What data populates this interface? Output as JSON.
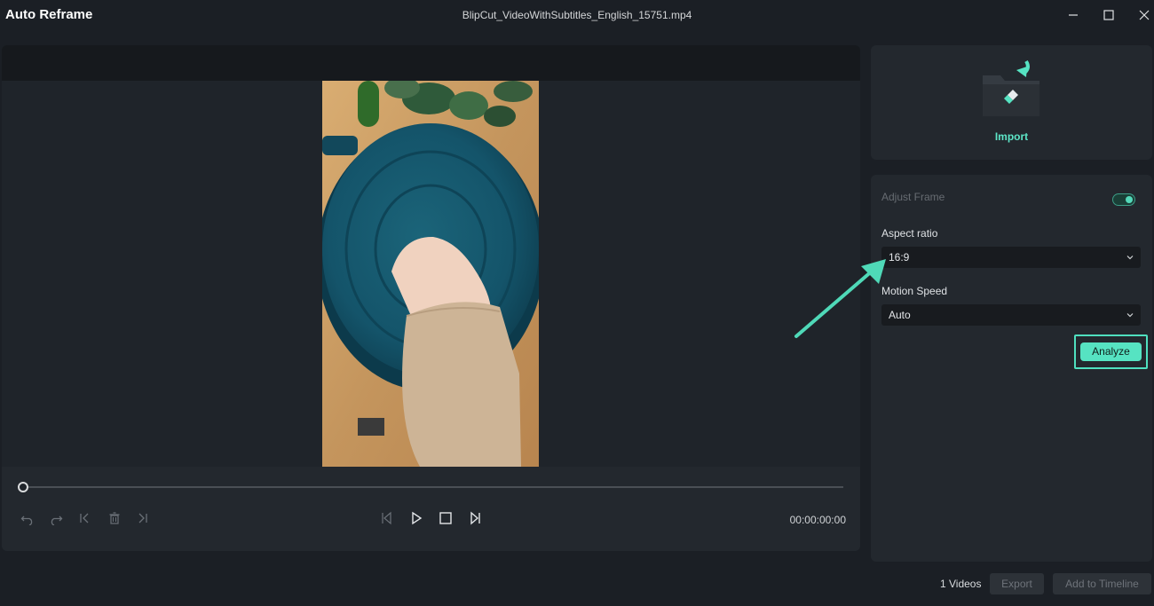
{
  "app": {
    "title": "Auto Reframe",
    "file_name": "BlipCut_VideoWithSubtitles_English_15751.mp4"
  },
  "window_controls": [
    "minimize-icon",
    "maximize-icon",
    "close-icon"
  ],
  "player": {
    "timecode": "00:00:00:00",
    "progress": 0,
    "left_controls": [
      "undo-icon",
      "redo-icon",
      "skip-start-icon",
      "delete-icon",
      "skip-end-icon"
    ],
    "center_controls": [
      "previous-frame-icon",
      "play-icon",
      "stop-icon",
      "next-frame-icon"
    ]
  },
  "import": {
    "label": "Import",
    "icon": "import-folder-icon"
  },
  "settings": {
    "adjust_frame_label": "Adjust Frame",
    "adjust_frame_on": true,
    "aspect_ratio_label": "Aspect ratio",
    "aspect_ratio_value": "16:9",
    "motion_speed_label": "Motion Speed",
    "motion_speed_value": "Auto",
    "analyze_label": "Analyze"
  },
  "footer": {
    "count_label": "1 Videos",
    "export_label": "Export",
    "add_label": "Add to Timeline"
  },
  "colors": {
    "accent": "#56e3c2",
    "background": "#1b1f25",
    "panel": "#23282e"
  }
}
